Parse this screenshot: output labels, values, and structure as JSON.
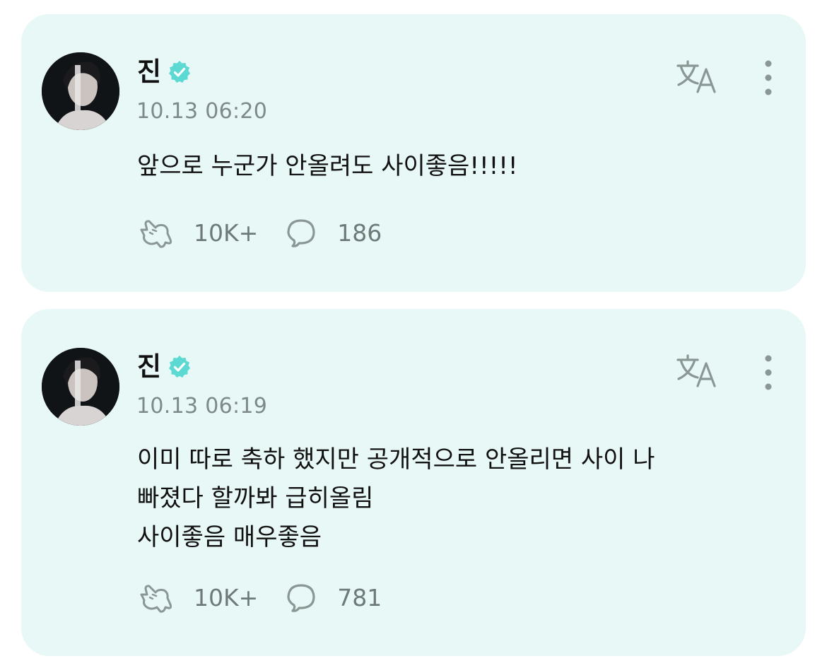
{
  "posts": [
    {
      "author": "진",
      "timestamp": "10.13 06:20",
      "content": "앞으로 누군가 안올려도 사이좋음!!!!!",
      "reactions": "10K+",
      "comments": "186"
    },
    {
      "author": "진",
      "timestamp": "10.13 06:19",
      "content": "이미 따로 축하 했지만 공개적으로 안올리면 사이 나\n빠졌다 할까봐 급히올림\n사이좋음 매우좋음",
      "reactions": "10K+",
      "comments": "781"
    }
  ],
  "colors": {
    "card_background": "#e7f8f6",
    "verified_badge": "#5cd9d2",
    "icon_gray": "#8b9795",
    "timestamp": "#7d8a88"
  },
  "icons": {
    "verified": "verified-badge-icon",
    "translate": "translate-icon",
    "more": "more-vertical-icon",
    "reaction": "reaction-icon",
    "comment": "comment-bubble-icon"
  }
}
